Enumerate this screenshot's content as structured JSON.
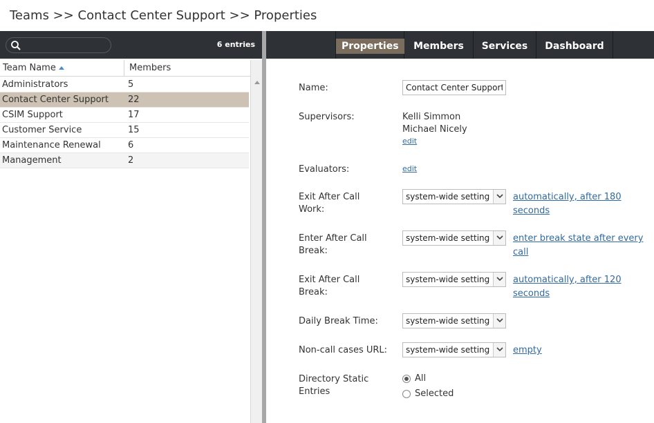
{
  "breadcrumb": "Teams >> Contact Center Support >> Properties",
  "list": {
    "entries": "6 entries",
    "search_placeholder": "",
    "columns": {
      "name": "Team Name",
      "members": "Members"
    },
    "rows": [
      {
        "name": "Administrators",
        "members": "5"
      },
      {
        "name": "Contact Center Support",
        "members": "22"
      },
      {
        "name": "CSIM Support",
        "members": "17"
      },
      {
        "name": "Customer Service",
        "members": "15"
      },
      {
        "name": "Maintenance Renewal",
        "members": "6"
      },
      {
        "name": "Management",
        "members": "2"
      }
    ]
  },
  "tabs": {
    "properties": "Properties",
    "members": "Members",
    "services": "Services",
    "dashboard": "Dashboard"
  },
  "form": {
    "name_label": "Name:",
    "name_value": "Contact Center Support",
    "supervisors_label": "Supervisors:",
    "supervisors": [
      "Kelli Simmon",
      "Michael Nicely"
    ],
    "edit": "edit",
    "evaluators_label": "Evaluators:",
    "exit_acw_label_1": "Exit After Call",
    "exit_acw_label_2": "Work:",
    "exit_acw_select": "system-wide setting",
    "exit_acw_link_1": "automatically, after 180",
    "exit_acw_link_2": "seconds",
    "enter_acb_label_1": "Enter After Call",
    "enter_acb_label_2": "Break:",
    "enter_acb_select": "system-wide setting",
    "enter_acb_link_1": "enter break state after every",
    "enter_acb_link_2": "call",
    "exit_acb_label_1": "Exit After Call",
    "exit_acb_label_2": "Break:",
    "exit_acb_select": "system-wide setting",
    "exit_acb_link_1": "automatically, after 120",
    "exit_acb_link_2": "seconds",
    "daily_break_label": "Daily Break Time:",
    "daily_break_select": "system-wide setting",
    "noncall_label": "Non-call cases URL:",
    "noncall_select": "system-wide setting",
    "noncall_link": "empty",
    "dir_label_1": "Directory Static",
    "dir_label_2": "Entries",
    "radio_all": "All",
    "radio_selected": "Selected"
  }
}
